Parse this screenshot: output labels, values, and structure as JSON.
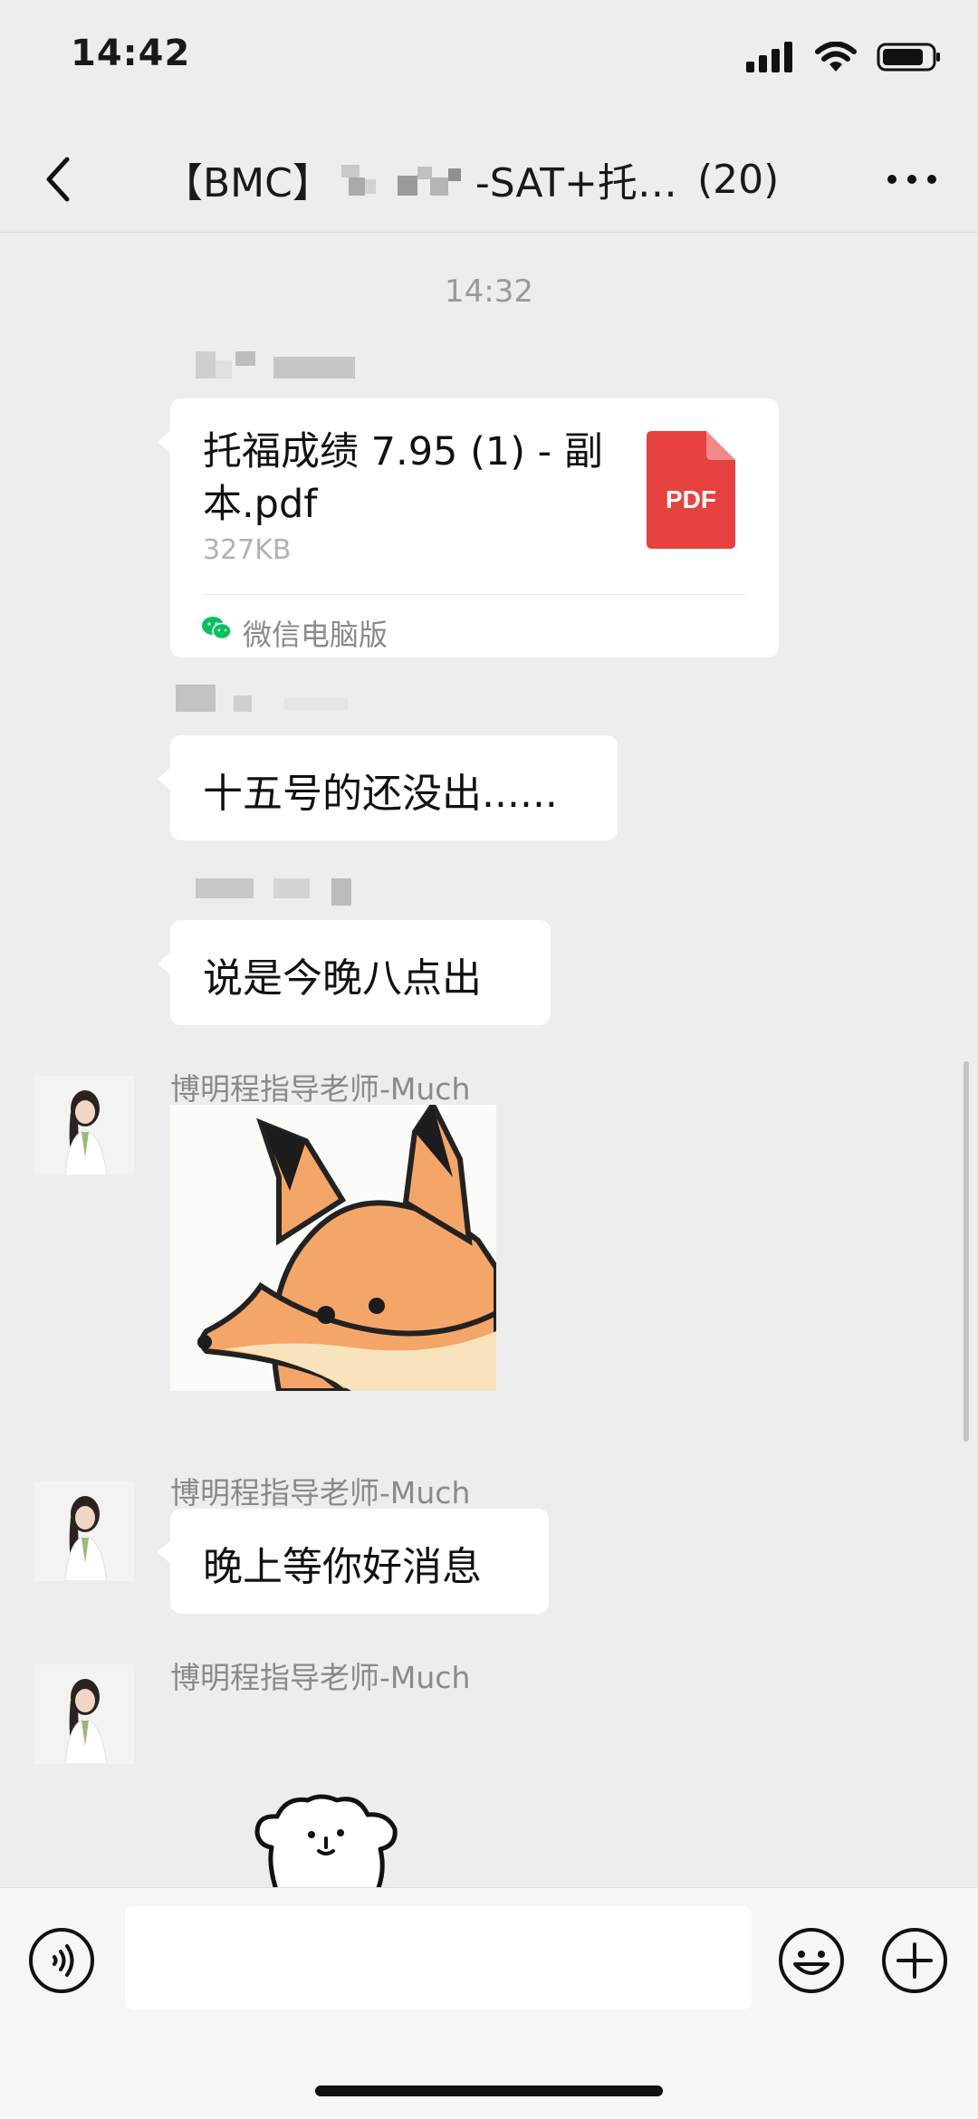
{
  "status_bar": {
    "time": "14:42"
  },
  "header": {
    "title_prefix": "【BMC】",
    "title_suffix": "-SAT+托…",
    "member_count": "(20)"
  },
  "chat": {
    "timestamp": "14:32",
    "messages": [
      {
        "type": "file",
        "file_name": "托福成绩 7.95 (1) - 副本.pdf",
        "file_size": "327KB",
        "file_type_label": "PDF",
        "source": "微信电脑版"
      },
      {
        "type": "text",
        "text": "十五号的还没出......"
      },
      {
        "type": "text",
        "text": "说是今晚八点出"
      },
      {
        "type": "sticker",
        "sender": "博明程指导老师-Much"
      },
      {
        "type": "text",
        "sender": "博明程指导老师-Much",
        "text": "晚上等你好消息"
      },
      {
        "type": "sticker",
        "sender": "博明程指导老师-Much"
      }
    ]
  },
  "input_bar": {
    "placeholder": ""
  },
  "colors": {
    "background": "#ededed",
    "bubble": "#ffffff",
    "pdf_red": "#e5423f",
    "wechat_green": "#07c160"
  }
}
